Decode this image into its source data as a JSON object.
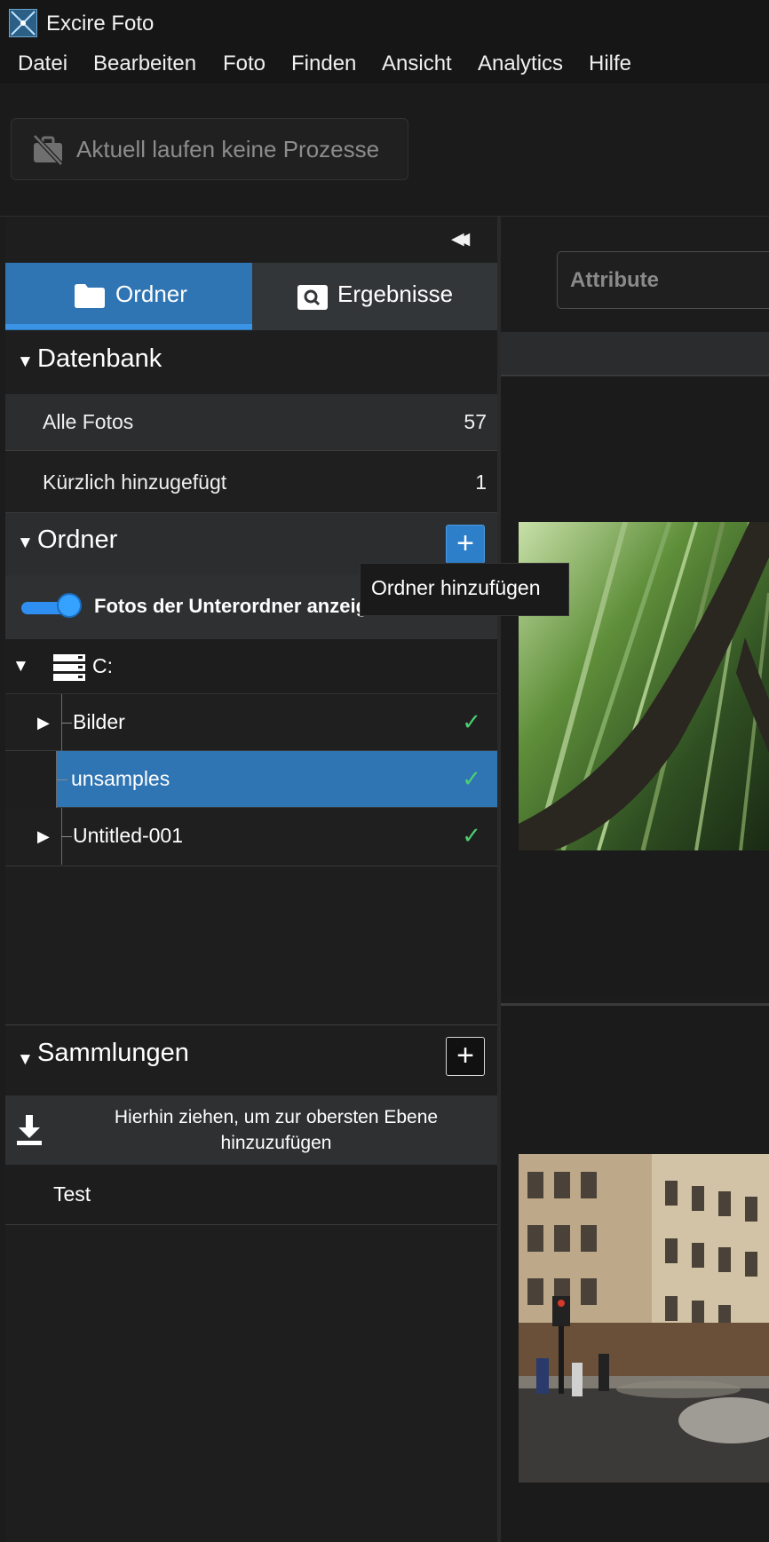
{
  "window": {
    "title": "Excire Foto"
  },
  "menu": [
    "Datei",
    "Bearbeiten",
    "Foto",
    "Finden",
    "Ansicht",
    "Analytics",
    "Hilfe"
  ],
  "process": {
    "status": "Aktuell laufen keine Prozesse"
  },
  "tabs": {
    "ordner": "Ordner",
    "ergebnisse": "Ergebnisse"
  },
  "datenbank": {
    "title": "Datenbank",
    "items": [
      {
        "label": "Alle Fotos",
        "count": "57"
      },
      {
        "label": "Kürzlich hinzugefügt",
        "count": "1"
      }
    ]
  },
  "ordner": {
    "title": "Ordner",
    "toggle_label": "Fotos der Unterordner anzeigen",
    "toggle_on": true,
    "tooltip": "Ordner hinzufügen",
    "drive": "C:",
    "tree": [
      {
        "label": "Bilder",
        "selected": false
      },
      {
        "label": "unsamples",
        "selected": true
      },
      {
        "label": "Untitled-001",
        "selected": false
      }
    ]
  },
  "sammlungen": {
    "title": "Sammlungen",
    "drop_hint": "Hierhin ziehen, um zur obersten Ebene hinzuzufügen",
    "items": [
      "Test"
    ]
  },
  "filter": {
    "attribute_placeholder": "Attribute"
  },
  "colors": {
    "accent": "#2f74b3",
    "check": "#4ccf72",
    "toggle": "#35a2ff"
  }
}
